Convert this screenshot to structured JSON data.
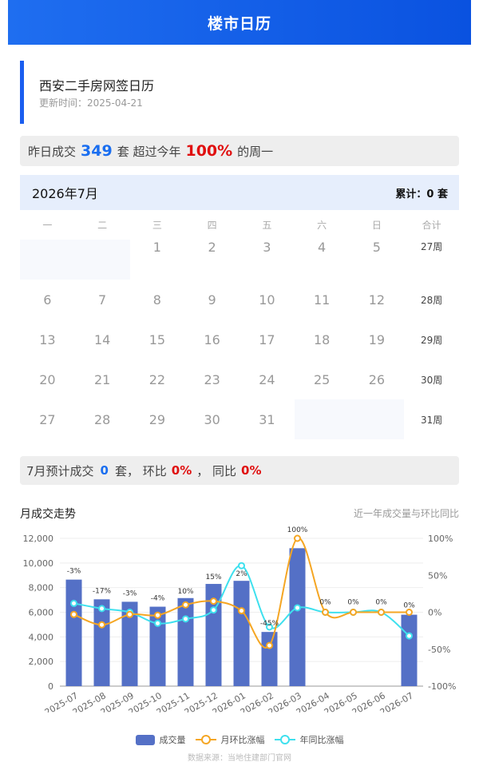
{
  "header": {
    "title": "楼市日历"
  },
  "page": {
    "title": "西安二手房网签日历",
    "updated": "更新时间：2025-04-21"
  },
  "summary": {
    "prefix": "昨日成交",
    "count": "349",
    "unit_text": "套 超过今年",
    "percent": "100%",
    "suffix": "的周一"
  },
  "calendar": {
    "month_label": "2026年7月",
    "total_label": "累计：0 套",
    "weekdays": [
      "一",
      "二",
      "三",
      "四",
      "五",
      "六",
      "日",
      "合计"
    ],
    "rows": [
      {
        "days": [
          "",
          "",
          "1",
          "2",
          "3",
          "4",
          "5"
        ],
        "week": "27周"
      },
      {
        "days": [
          "6",
          "7",
          "8",
          "9",
          "10",
          "11",
          "12"
        ],
        "week": "28周"
      },
      {
        "days": [
          "13",
          "14",
          "15",
          "16",
          "17",
          "18",
          "19"
        ],
        "week": "29周"
      },
      {
        "days": [
          "20",
          "21",
          "22",
          "23",
          "24",
          "25",
          "26"
        ],
        "week": "30周"
      },
      {
        "days": [
          "27",
          "28",
          "29",
          "30",
          "31",
          "",
          ""
        ],
        "week": "31周"
      }
    ]
  },
  "prediction": {
    "prefix": "7月预计成交",
    "count": "0",
    "unit": "套，  环比",
    "mom": "0%",
    "sep": "，  同比",
    "yoy": "0%"
  },
  "trend": {
    "title": "月成交走势",
    "subtitle": "近一年成交量与环比同比"
  },
  "legend": {
    "bar": "成交量",
    "mom": "月环比涨幅",
    "yoy": "年同比涨幅"
  },
  "footer": "数据来源：当地住建部门官网",
  "colors": {
    "bar": "#5470c6",
    "mom": "#f5a623",
    "yoy": "#3ee0ee",
    "accent": "#1a5ef0"
  },
  "chart_data": {
    "type": "bar",
    "categories": [
      "2025-07",
      "2025-08",
      "2025-09",
      "2025-10",
      "2025-11",
      "2025-12",
      "2026-01",
      "2026-02",
      "2026-03",
      "2026-04",
      "2026-05",
      "2026-06",
      "2026-07"
    ],
    "series": [
      {
        "name": "成交量",
        "type": "bar",
        "axis": "left",
        "values": [
          8650,
          7050,
          6850,
          6450,
          7150,
          8300,
          8550,
          4400,
          11200,
          0,
          0,
          0,
          5800
        ]
      },
      {
        "name": "月环比涨幅",
        "type": "line",
        "axis": "right",
        "values": [
          -3,
          -17,
          -3,
          -4,
          10,
          15,
          2,
          -45,
          100,
          0,
          0,
          0,
          0
        ],
        "labels": [
          "-3%",
          "-17%",
          "-3%",
          "-4%",
          "10%",
          "15%",
          "2%",
          "-45%",
          "100%",
          "0%",
          "0%",
          "0%",
          "0%"
        ]
      },
      {
        "name": "年同比涨幅",
        "type": "line",
        "axis": "right",
        "values": [
          12,
          5,
          0,
          -15,
          -9,
          3,
          63,
          -20,
          6,
          0,
          0,
          0,
          -32
        ]
      }
    ],
    "left_axis": {
      "ticks": [
        "0",
        "2,000",
        "4,000",
        "6,000",
        "8,000",
        "10,000",
        "12,000"
      ],
      "range": [
        0,
        12000
      ]
    },
    "right_axis": {
      "ticks": [
        "-100%",
        "-50%",
        "0%",
        "50%",
        "100%"
      ],
      "range": [
        -100,
        100
      ]
    }
  }
}
